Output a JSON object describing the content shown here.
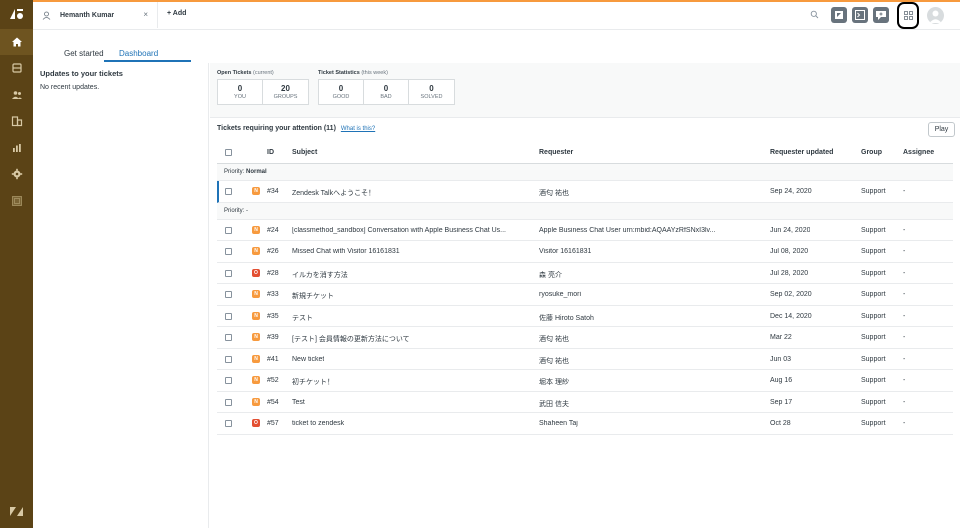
{
  "colors": {
    "nav_bg": "#5b4316",
    "accent": "#1f73b7",
    "new_badge": "#f79a3e",
    "open_badge": "#e34f32"
  },
  "nav": {
    "items": [
      "home-icon",
      "views-icon",
      "customers-icon",
      "organizations-icon",
      "reporting-icon",
      "admin-icon",
      "apps-icon"
    ]
  },
  "topbar": {
    "tab_user": "Hemanth Kumar",
    "add_label": "+ Add"
  },
  "subtabs": {
    "get_started": "Get started",
    "dashboard": "Dashboard"
  },
  "left": {
    "title": "Updates to your tickets",
    "empty": "No recent updates."
  },
  "open_tickets": {
    "label": "Open Tickets",
    "qualifier": "(current)",
    "boxes": [
      {
        "value": "0",
        "label": "YOU"
      },
      {
        "value": "20",
        "label": "GROUPS"
      }
    ]
  },
  "ticket_stats": {
    "label": "Ticket Statistics",
    "qualifier": "(this week)",
    "boxes": [
      {
        "value": "0",
        "label": "GOOD"
      },
      {
        "value": "0",
        "label": "BAD"
      },
      {
        "value": "0",
        "label": "SOLVED"
      }
    ]
  },
  "tickets": {
    "title": "Tickets requiring your attention (11)",
    "what_link": "What is this?",
    "play": "Play",
    "columns": [
      "ID",
      "Subject",
      "Requester",
      "Requester updated",
      "Group",
      "Assignee"
    ],
    "group_normal_label": "Priority:",
    "group_normal_value": "Normal",
    "group_none": "Priority: -",
    "rows": [
      {
        "status": "N",
        "id": "#34",
        "subject": "Zendesk Talkへようこそ！",
        "requester": "酒匂 祐也",
        "updated": "Sep 24, 2020",
        "group": "Support",
        "assignee": "-"
      },
      {
        "status": "N",
        "id": "#24",
        "subject": "[classmethod_sandbox] Conversation with Apple Business Chat Us...",
        "requester": "Apple Business Chat User urn:mbid:AQAAYzRfSNxI3lv...",
        "updated": "Jun 24, 2020",
        "group": "Support",
        "assignee": "-"
      },
      {
        "status": "N",
        "id": "#26",
        "subject": "Missed Chat with Visitor 16161831",
        "requester": "Visitor 16161831",
        "updated": "Jul 08, 2020",
        "group": "Support",
        "assignee": "-"
      },
      {
        "status": "O",
        "id": "#28",
        "subject": "イルカを消す方法",
        "requester": "森 亮介",
        "updated": "Jul 28, 2020",
        "group": "Support",
        "assignee": "-"
      },
      {
        "status": "N",
        "id": "#33",
        "subject": "新規チケット",
        "requester": "ryosuke_mori",
        "updated": "Sep 02, 2020",
        "group": "Support",
        "assignee": "-"
      },
      {
        "status": "N",
        "id": "#35",
        "subject": "テスト",
        "requester": "佐藤 Hiroto Satoh",
        "updated": "Dec 14, 2020",
        "group": "Support",
        "assignee": "-"
      },
      {
        "status": "N",
        "id": "#39",
        "subject": "[テスト] 会員情報の更新方法について",
        "requester": "酒匂 祐也",
        "updated": "Mar 22",
        "group": "Support",
        "assignee": "-"
      },
      {
        "status": "N",
        "id": "#41",
        "subject": "New ticket",
        "requester": "酒匂 祐也",
        "updated": "Jun 03",
        "group": "Support",
        "assignee": "-"
      },
      {
        "status": "N",
        "id": "#52",
        "subject": "初チケット！",
        "requester": "堀本 理紗",
        "updated": "Aug 16",
        "group": "Support",
        "assignee": "-"
      },
      {
        "status": "N",
        "id": "#54",
        "subject": "Test",
        "requester": "武田 信夫",
        "updated": "Sep 17",
        "group": "Support",
        "assignee": "-"
      },
      {
        "status": "O",
        "id": "#57",
        "subject": "ticket to zendesk",
        "requester": "Shaheen Taj",
        "updated": "Oct 28",
        "group": "Support",
        "assignee": "-"
      }
    ]
  }
}
